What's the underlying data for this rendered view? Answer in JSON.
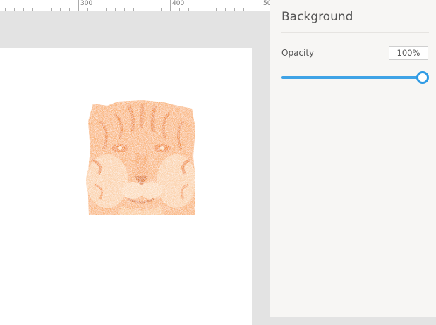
{
  "ruler": {
    "labels": [
      "300",
      "400",
      "50"
    ]
  },
  "panel": {
    "title": "Background",
    "opacity": {
      "label": "Opacity",
      "value_text": "100%",
      "value": 1.0
    }
  },
  "colors": {
    "accent": "#2d9ae4",
    "tiger_tint": "#f6a25a"
  },
  "artboard": {
    "image": "tiger-image"
  }
}
